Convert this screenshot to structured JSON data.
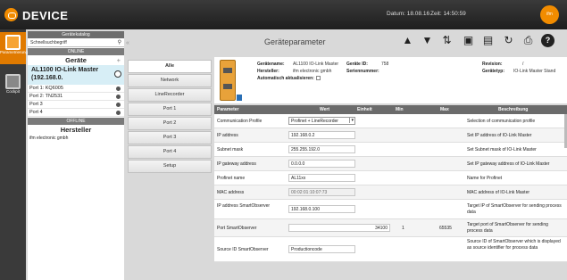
{
  "header": {
    "title": "DEVICE",
    "date_label": "Datum: 18.08.16",
    "time_label": "Zeit: 14:50:59",
    "user_label": "ifm",
    "accent": "#f28c00"
  },
  "leftnav": [
    {
      "label": "Parametrierung",
      "icon": "parametrize-icon"
    },
    {
      "label": "Cockpit",
      "icon": "cockpit-icon"
    }
  ],
  "catalog": {
    "header": "Gerätekatalog",
    "search_placeholder": "Schnellsuchbegriff",
    "online_header": "ONLINE",
    "devices_group": "Geräte",
    "device_name": "AL1100 IO-Link Master (192.168.0.",
    "ports": [
      "Port 1: KQ6005",
      "Port 2: TN2531",
      "Port 3",
      "Port 4"
    ],
    "offline_header": "OFFLINE",
    "manufacturer_group": "Hersteller",
    "manufacturer_item": "ifm electronic gmbh"
  },
  "nav_buttons": [
    "Alle",
    "Network",
    "LineRecorder",
    "Port 1",
    "Port 2",
    "Port 3",
    "Port 4",
    "Setup"
  ],
  "panel": {
    "title": "Geräteparameter"
  },
  "info": {
    "device_name_label": "Gerätename:",
    "device_name_value": "AL1100 IO-Link Master",
    "vendor_label": "Hersteller:",
    "vendor_value": "ifm electronic gmbh",
    "auto_update_label": "Automatisch aktualisieren:",
    "device_id_label": "Geräte ID:",
    "device_id_value": "758",
    "serial_label": "Seriennummer:",
    "serial_value": "",
    "revision_label": "Revision:",
    "revision_value": "/",
    "device_type_label": "Gerätetyp:",
    "device_type_value": "IO-Link Master Stand"
  },
  "table": {
    "headers": [
      "Parameter",
      "Wert",
      "Einheit",
      "Min",
      "Max",
      "Beschreibung"
    ],
    "rows": [
      {
        "param": "Communication Profile",
        "value": "Profinet + LineRecorder",
        "kind": "select",
        "unit": "",
        "min": "",
        "max": "",
        "desc": "Selection of communication profile"
      },
      {
        "param": "IP address",
        "value": "192.168.0.2",
        "kind": "input",
        "unit": "",
        "min": "",
        "max": "",
        "desc": "Set IP address of IO-Link Master"
      },
      {
        "param": "Subnet mask",
        "value": "255.255.192.0",
        "kind": "input",
        "unit": "",
        "min": "",
        "max": "",
        "desc": "Set Subnet mask of IO-Link Master"
      },
      {
        "param": "IP gateway address",
        "value": "0.0.0.0",
        "kind": "input",
        "unit": "",
        "min": "",
        "max": "",
        "desc": "Set IP gateway address of IO-Link Master"
      },
      {
        "param": "Profinet name",
        "value": "AL11xx",
        "kind": "input",
        "unit": "",
        "min": "",
        "max": "",
        "desc": "Name for Profinet"
      },
      {
        "param": "MAC address",
        "value": "00:02:01:10:07:73",
        "kind": "disabled",
        "unit": "",
        "min": "",
        "max": "",
        "desc": "MAC address of IO-Link Master"
      },
      {
        "param": "IP address SmartObserver",
        "value": "192.168.0.100",
        "kind": "input",
        "unit": "",
        "min": "",
        "max": "",
        "desc": "Target IP of SmartObserver for sending process data"
      },
      {
        "param": "Port SmartObserver",
        "value": "34100",
        "kind": "input-right",
        "unit": "",
        "min": "1",
        "max": "65535",
        "desc": "Target port of SmartObserver for sending process data"
      },
      {
        "param": "Source ID SmartObserver",
        "value": "Productioncode",
        "kind": "input",
        "unit": "",
        "min": "",
        "max": "",
        "desc": "Source ID of SmartObserver which is displayed as source identifier for process data"
      }
    ]
  },
  "toolbar_icons": [
    "upload-icon",
    "download-icon",
    "transfer-icon",
    "export-icon",
    "import-icon",
    "refresh-icon",
    "print-icon",
    "help-icon"
  ]
}
